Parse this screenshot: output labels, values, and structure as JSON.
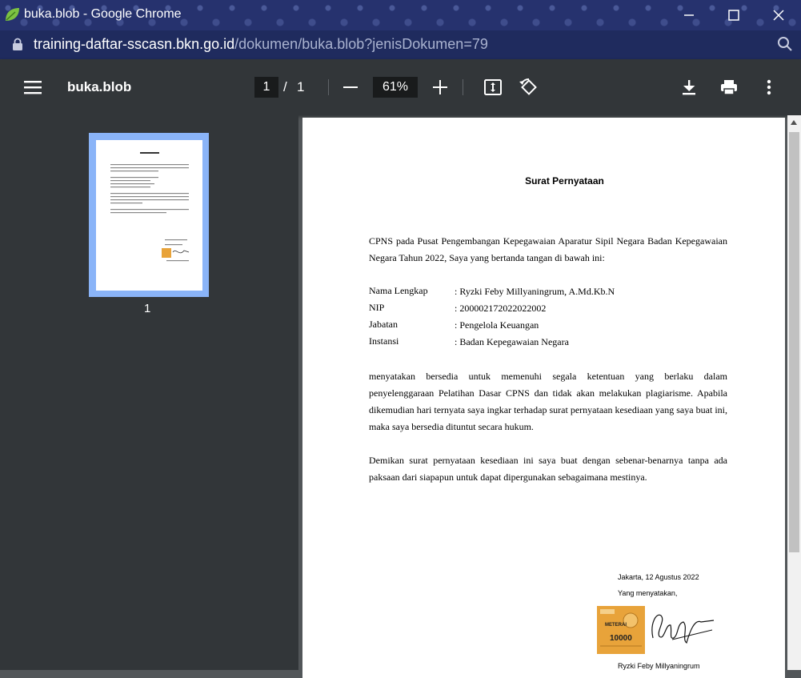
{
  "window": {
    "title": "buka.blob - Google Chrome",
    "minimize": "—",
    "maximize": "☐",
    "close": "✕"
  },
  "address": {
    "domain": "training-daftar-sscasn.bkn.go.id",
    "path": "/dokumen/buka.blob?jenisDokumen=79"
  },
  "toolbar": {
    "doc_title": "buka.blob",
    "page_current": "1",
    "page_separator": "/",
    "page_total": "1",
    "zoom": "61%"
  },
  "sidebar": {
    "thumb_number": "1"
  },
  "document": {
    "heading": "Surat Pernyataan",
    "intro": "CPNS pada Pusat Pengembangan Kepegawaian Aparatur Sipil Negara Badan Kepegawaian Negara Tahun 2022, Saya yang bertanda tangan di bawah ini:",
    "fields": [
      {
        "label": "Nama Lengkap",
        "value": ": Ryzki Feby Millyaningrum, A.Md.Kb.N"
      },
      {
        "label": "NIP",
        "value": ": 200002172022022002"
      },
      {
        "label": "Jabatan",
        "value": ": Pengelola Keuangan"
      },
      {
        "label": "Instansi",
        "value": ": Badan Kepegawaian Negara"
      }
    ],
    "body": "menyatakan bersedia untuk memenuhi segala ketentuan yang berlaku dalam penyelenggaraan Pelatihan Dasar CPNS dan tidak akan melakukan plagiarisme. Apabila dikemudian hari ternyata saya ingkar terhadap surat pernyataan kesediaan yang saya buat ini, maka saya bersedia dituntut secara hukum.",
    "closing": "Demikan surat pernyataan kesediaan ini saya buat dengan sebenar-benarnya tanpa ada paksaan dari siapapun untuk dapat dipergunakan sebagaimana mestinya.",
    "place_date": "Jakarta, 12 Agustus 2022",
    "statement": "Yang menyatakan,",
    "materai_label": "METERAI",
    "materai_value": "10000",
    "signer_name": "Ryzki Feby Millyaningrum"
  },
  "colors": {
    "titlebar": "#26326e",
    "toolbar": "#323639",
    "viewer_bg": "#525659",
    "thumb_highlight": "#8ab4f8"
  }
}
